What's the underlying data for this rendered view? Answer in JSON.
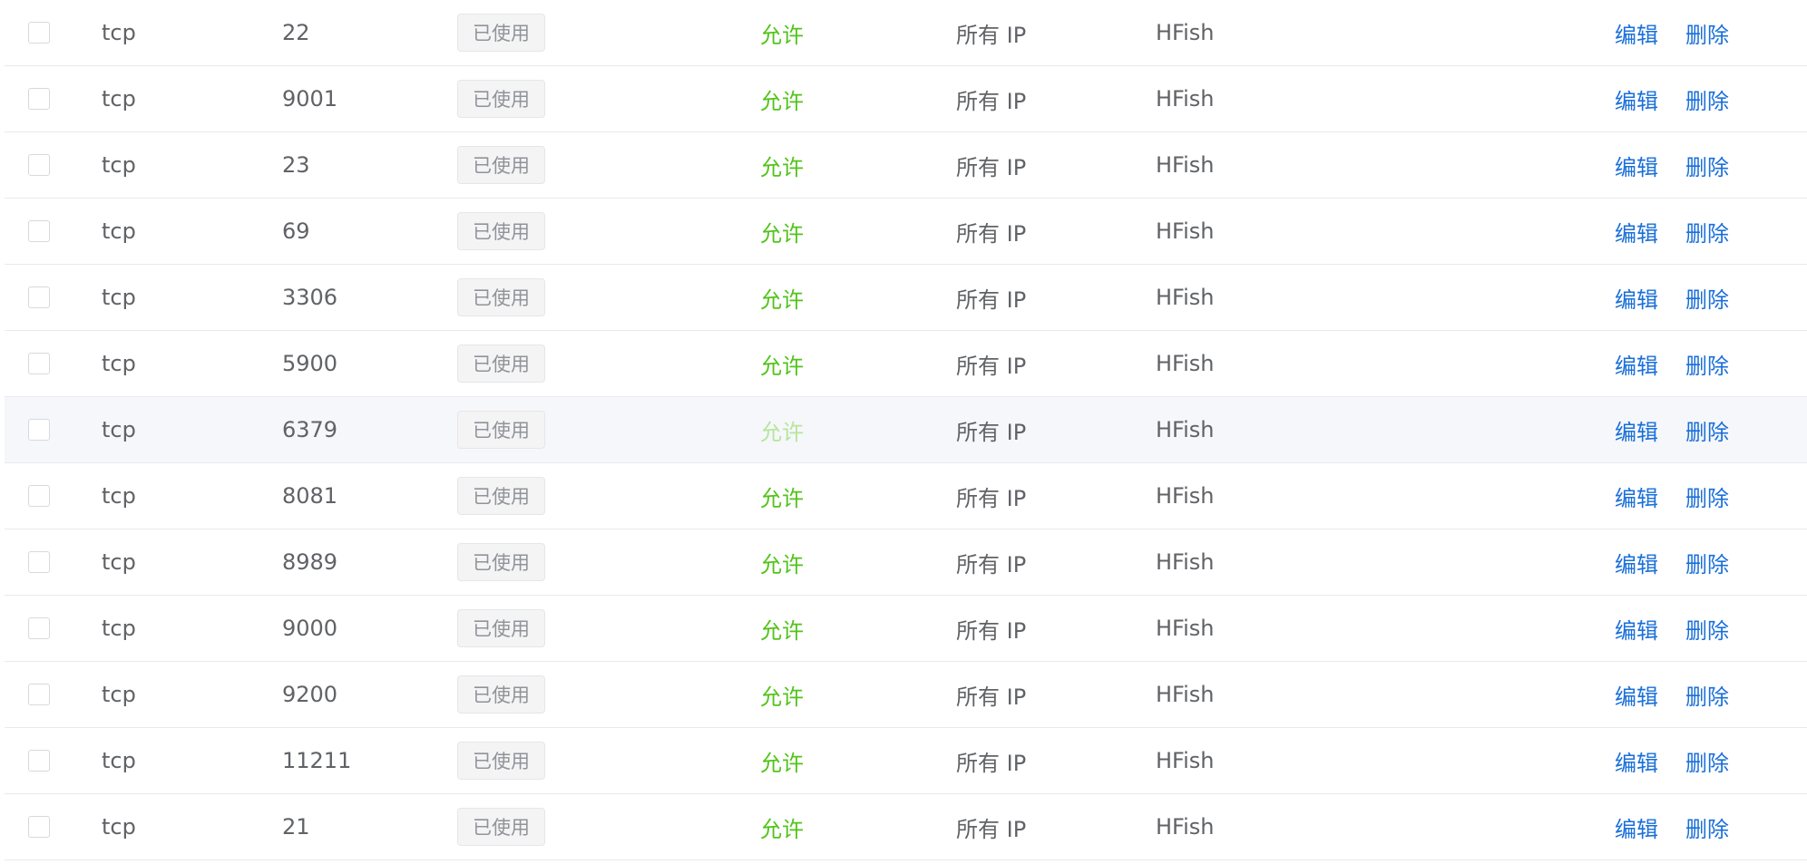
{
  "table": {
    "rows": [
      {
        "protocol": "tcp",
        "port": "22",
        "status": "已使用",
        "policy": "允许",
        "ip_range": "所有 IP",
        "name": "HFish",
        "edit": "编辑",
        "delete": "删除"
      },
      {
        "protocol": "tcp",
        "port": "9001",
        "status": "已使用",
        "policy": "允许",
        "ip_range": "所有 IP",
        "name": "HFish",
        "edit": "编辑",
        "delete": "删除"
      },
      {
        "protocol": "tcp",
        "port": "23",
        "status": "已使用",
        "policy": "允许",
        "ip_range": "所有 IP",
        "name": "HFish",
        "edit": "编辑",
        "delete": "删除"
      },
      {
        "protocol": "tcp",
        "port": "69",
        "status": "已使用",
        "policy": "允许",
        "ip_range": "所有 IP",
        "name": "HFish",
        "edit": "编辑",
        "delete": "删除"
      },
      {
        "protocol": "tcp",
        "port": "3306",
        "status": "已使用",
        "policy": "允许",
        "ip_range": "所有 IP",
        "name": "HFish",
        "edit": "编辑",
        "delete": "删除"
      },
      {
        "protocol": "tcp",
        "port": "5900",
        "status": "已使用",
        "policy": "允许",
        "ip_range": "所有 IP",
        "name": "HFish",
        "edit": "编辑",
        "delete": "删除"
      },
      {
        "protocol": "tcp",
        "port": "6379",
        "status": "已使用",
        "policy": "允许",
        "ip_range": "所有 IP",
        "name": "HFish",
        "edit": "编辑",
        "delete": "删除",
        "hovered": true
      },
      {
        "protocol": "tcp",
        "port": "8081",
        "status": "已使用",
        "policy": "允许",
        "ip_range": "所有 IP",
        "name": "HFish",
        "edit": "编辑",
        "delete": "删除"
      },
      {
        "protocol": "tcp",
        "port": "8989",
        "status": "已使用",
        "policy": "允许",
        "ip_range": "所有 IP",
        "name": "HFish",
        "edit": "编辑",
        "delete": "删除"
      },
      {
        "protocol": "tcp",
        "port": "9000",
        "status": "已使用",
        "policy": "允许",
        "ip_range": "所有 IP",
        "name": "HFish",
        "edit": "编辑",
        "delete": "删除"
      },
      {
        "protocol": "tcp",
        "port": "9200",
        "status": "已使用",
        "policy": "允许",
        "ip_range": "所有 IP",
        "name": "HFish",
        "edit": "编辑",
        "delete": "删除"
      },
      {
        "protocol": "tcp",
        "port": "11211",
        "status": "已使用",
        "policy": "允许",
        "ip_range": "所有 IP",
        "name": "HFish",
        "edit": "编辑",
        "delete": "删除"
      },
      {
        "protocol": "tcp",
        "port": "21",
        "status": "已使用",
        "policy": "允许",
        "ip_range": "所有 IP",
        "name": "HFish",
        "edit": "编辑",
        "delete": "删除"
      }
    ]
  },
  "colors": {
    "allow_green": "#52c41a",
    "link_blue": "#1a6fd9",
    "text_gray": "#606266",
    "hover_row_bg": "#f5f7fa"
  }
}
